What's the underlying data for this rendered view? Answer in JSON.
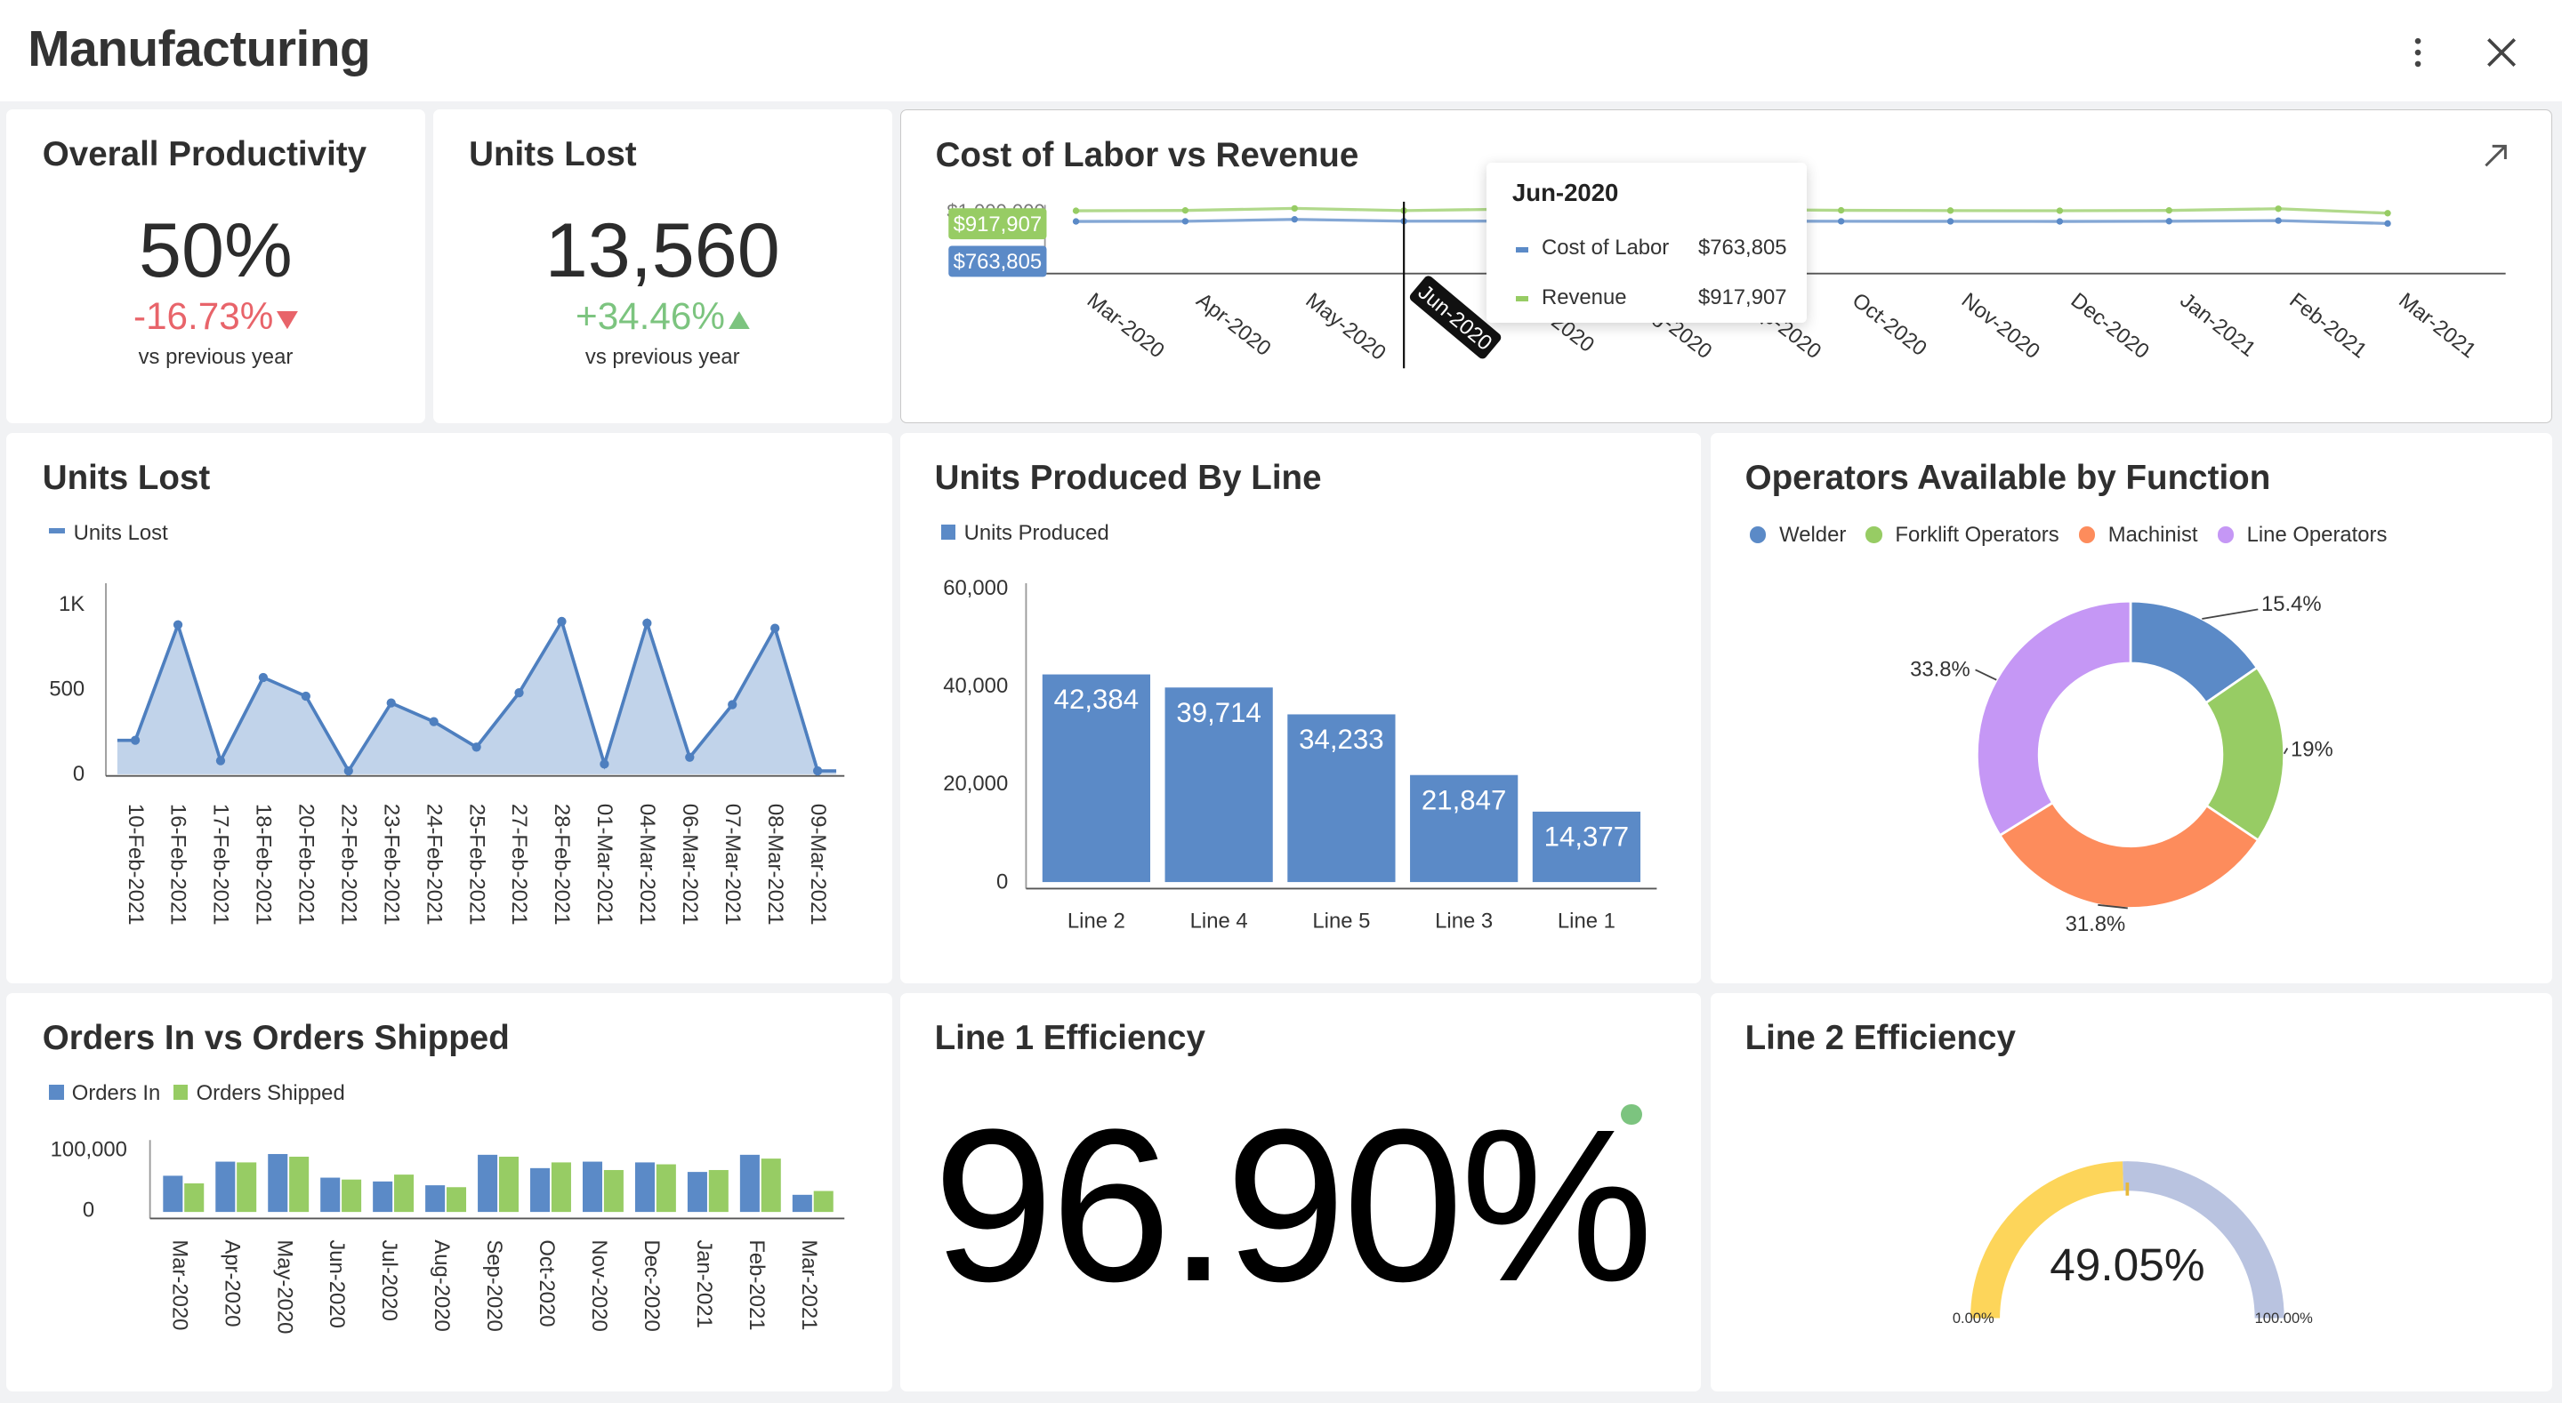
{
  "header": {
    "title": "Manufacturing",
    "menu_icon": "more-vertical-icon",
    "close_icon": "close-icon"
  },
  "colors": {
    "blue": "#5b8ac7",
    "green": "#97cc64",
    "orange": "#fd8c5c",
    "purple": "#c597f5",
    "red": "#e8646a",
    "positive": "#7cc47f",
    "gauge_fill": "#fdd55a",
    "gauge_rest": "#b9c3e0",
    "dot_green": "#7cc47f"
  },
  "kpi_productivity": {
    "title": "Overall Productivity",
    "value": "50%",
    "delta": "-16.73%",
    "delta_direction": "down",
    "sub": "vs previous year"
  },
  "kpi_units_lost": {
    "title": "Units Lost",
    "value": "13,560",
    "delta": "+34.46%",
    "delta_direction": "up",
    "sub": "vs previous year"
  },
  "labor_vs_revenue": {
    "title": "Cost of Labor vs Revenue",
    "expand_icon": "expand-arrow-icon",
    "top_tick_partial": "$1,000,000",
    "hover_revenue_tag": "$917,907",
    "hover_labor_tag": "$763,805",
    "tooltip": {
      "title": "Jun-2020",
      "rows": [
        {
          "label": "Cost of Labor",
          "value": "$763,805"
        },
        {
          "label": "Revenue",
          "value": "$917,907"
        }
      ]
    },
    "hover_category": "Jun-2020",
    "hover_index": 3
  },
  "units_lost_chart": {
    "title": "Units Lost",
    "legend": "Units Lost"
  },
  "units_produced": {
    "title": "Units Produced By Line",
    "legend": "Units Produced"
  },
  "operators": {
    "title": "Operators Available by Function",
    "legend": [
      "Welder",
      "Forklift Operators",
      "Machinist",
      "Line Operators"
    ]
  },
  "orders": {
    "title": "Orders In vs Orders Shipped",
    "legend": [
      "Orders In",
      "Orders Shipped"
    ]
  },
  "line1": {
    "title": "Line 1 Efficiency",
    "value": "96.90%",
    "status_dot": "green"
  },
  "line2": {
    "title": "Line 2 Efficiency",
    "value": "49.05%",
    "min_label": "0.00%",
    "max_label": "100.00%",
    "fraction": 0.4905
  },
  "chart_data": [
    {
      "type": "line",
      "title": "Cost of Labor vs Revenue",
      "categories": [
        "Mar-2020",
        "Apr-2020",
        "May-2020",
        "Jun-2020",
        "Jul-2020",
        "Aug-2020",
        "Sep-2020",
        "Oct-2020",
        "Nov-2020",
        "Dec-2020",
        "Jan-2021",
        "Feb-2021",
        "Mar-2021"
      ],
      "series": [
        {
          "name": "Cost of Labor",
          "values": [
            760000,
            762000,
            790000,
            763805,
            765000,
            762000,
            766000,
            762000,
            761000,
            760000,
            763000,
            772000,
            730000
          ]
        },
        {
          "name": "Revenue",
          "values": [
            915000,
            920000,
            950000,
            917907,
            940000,
            925000,
            935000,
            922000,
            918000,
            916000,
            920000,
            945000,
            880000
          ]
        }
      ],
      "ylim": [
        0,
        1000000
      ]
    },
    {
      "type": "area",
      "title": "Units Lost",
      "categories": [
        "10-Feb-2021",
        "16-Feb-2021",
        "17-Feb-2021",
        "18-Feb-2021",
        "20-Feb-2021",
        "22-Feb-2021",
        "23-Feb-2021",
        "24-Feb-2021",
        "25-Feb-2021",
        "27-Feb-2021",
        "28-Feb-2021",
        "01-Mar-2021",
        "04-Mar-2021",
        "06-Mar-2021",
        "07-Mar-2021",
        "08-Mar-2021",
        "09-Mar-2021"
      ],
      "series": [
        {
          "name": "Units Lost",
          "values": [
            200,
            880,
            80,
            570,
            460,
            20,
            420,
            310,
            160,
            480,
            900,
            60,
            890,
            100,
            410,
            860,
            20
          ]
        }
      ],
      "yticks": [
        "0",
        "500",
        "1K"
      ],
      "ylim": [
        0,
        1000
      ]
    },
    {
      "type": "bar",
      "title": "Units Produced By Line",
      "categories": [
        "Line 2",
        "Line 4",
        "Line 5",
        "Line 3",
        "Line 1"
      ],
      "series": [
        {
          "name": "Units Produced",
          "values": [
            42384,
            39714,
            34233,
            21847,
            14377
          ]
        }
      ],
      "data_labels": [
        "42,384",
        "39,714",
        "34,233",
        "21,847",
        "14,377"
      ],
      "yticks": [
        "0",
        "20,000",
        "40,000",
        "60,000"
      ],
      "ylim": [
        0,
        60000
      ]
    },
    {
      "type": "pie",
      "title": "Operators Available by Function",
      "labels": [
        "Welder",
        "Forklift Operators",
        "Machinist",
        "Line Operators"
      ],
      "values": [
        15.4,
        19,
        31.8,
        33.8
      ],
      "data_labels": [
        "15.4%",
        "19%",
        "31.8%",
        "33.8%"
      ]
    },
    {
      "type": "bar",
      "title": "Orders In vs Orders Shipped",
      "categories": [
        "Mar-2020",
        "Apr-2020",
        "May-2020",
        "Jun-2020",
        "Jul-2020",
        "Aug-2020",
        "Sep-2020",
        "Oct-2020",
        "Nov-2020",
        "Dec-2020",
        "Jan-2021",
        "Feb-2021",
        "Mar-2021"
      ],
      "series": [
        {
          "name": "Orders In",
          "values": [
            95000,
            132000,
            152000,
            90000,
            80000,
            70000,
            150000,
            115000,
            132000,
            130000,
            105000,
            150000,
            45000
          ]
        },
        {
          "name": "Orders Shipped",
          "values": [
            75000,
            130000,
            145000,
            85000,
            98000,
            65000,
            145000,
            130000,
            110000,
            125000,
            110000,
            140000,
            55000
          ]
        }
      ],
      "yticks": [
        "0",
        "100,000"
      ],
      "ylim": [
        0,
        200000
      ]
    }
  ]
}
